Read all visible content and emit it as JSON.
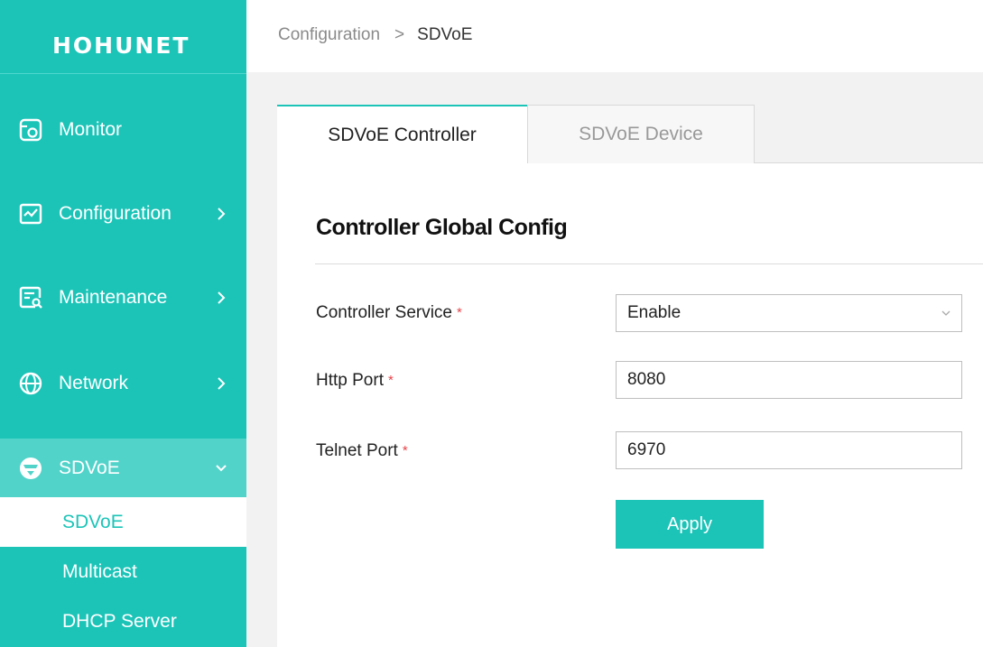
{
  "brand": {
    "name": "HOHUNET"
  },
  "sidebar": {
    "items": [
      {
        "label": "Monitor",
        "icon": "monitor-icon"
      },
      {
        "label": "Configuration",
        "icon": "configuration-icon"
      },
      {
        "label": "Maintenance",
        "icon": "maintenance-icon"
      },
      {
        "label": "Network",
        "icon": "globe-icon"
      },
      {
        "label": "SDVoE",
        "icon": "sdvoe-icon"
      }
    ],
    "subitems": [
      {
        "label": "SDVoE"
      },
      {
        "label": "Multicast"
      },
      {
        "label": "DHCP Server"
      }
    ]
  },
  "breadcrumb": {
    "parent": "Configuration",
    "separator": ">",
    "current": "SDVoE"
  },
  "tabs": [
    {
      "label": "SDVoE Controller"
    },
    {
      "label": "SDVoE Device"
    }
  ],
  "section": {
    "title": "Controller Global Config"
  },
  "form": {
    "controller_service": {
      "label": "Controller Service",
      "value": "Enable",
      "required_mark": "*"
    },
    "http_port": {
      "label": "Http Port",
      "value": "8080",
      "required_mark": "*"
    },
    "telnet_port": {
      "label": "Telnet Port",
      "value": "6970",
      "required_mark": "*"
    },
    "apply_label": "Apply"
  },
  "colors": {
    "accent": "#1cc4b8",
    "active_nav": "#52d3ca",
    "required": "#e8444a"
  }
}
